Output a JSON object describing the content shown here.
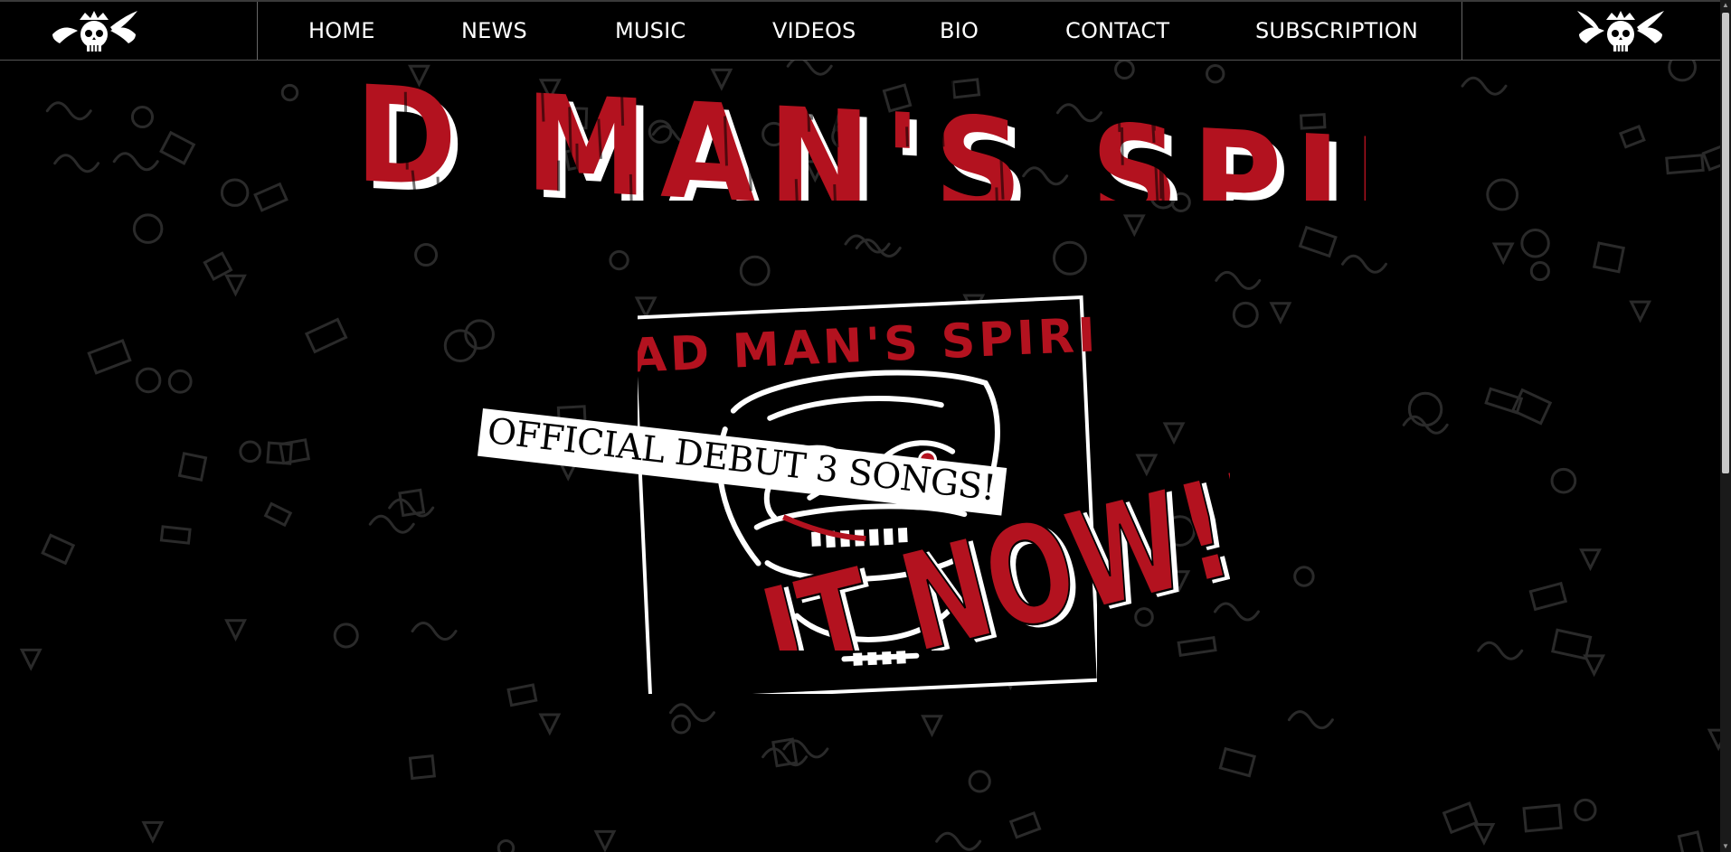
{
  "nav": {
    "items": [
      {
        "label": "HOME",
        "id": "home"
      },
      {
        "label": "NEWS",
        "id": "news"
      },
      {
        "label": "MUSIC",
        "id": "music"
      },
      {
        "label": "VIDEOS",
        "id": "videos"
      },
      {
        "label": "BIO",
        "id": "bio"
      },
      {
        "label": "CONTACT",
        "id": "contact"
      },
      {
        "label": "SUBSCRIPTION",
        "id": "subscription"
      }
    ]
  },
  "header": {
    "title": "MAD MAN'S SPIRIT"
  },
  "album": {
    "cover_title": "MAD MAN'S SPIRIT",
    "sticker": "OFFICIAL DEBUT 3 SONGS!",
    "headline": "OUT NOW!!!"
  },
  "logos": {
    "left": "winged-skull-crown-icon",
    "right": "winged-skull-crown-icon"
  },
  "colors": {
    "accent_red": "#b3121f",
    "text": "#ffffff",
    "background": "#000000"
  }
}
